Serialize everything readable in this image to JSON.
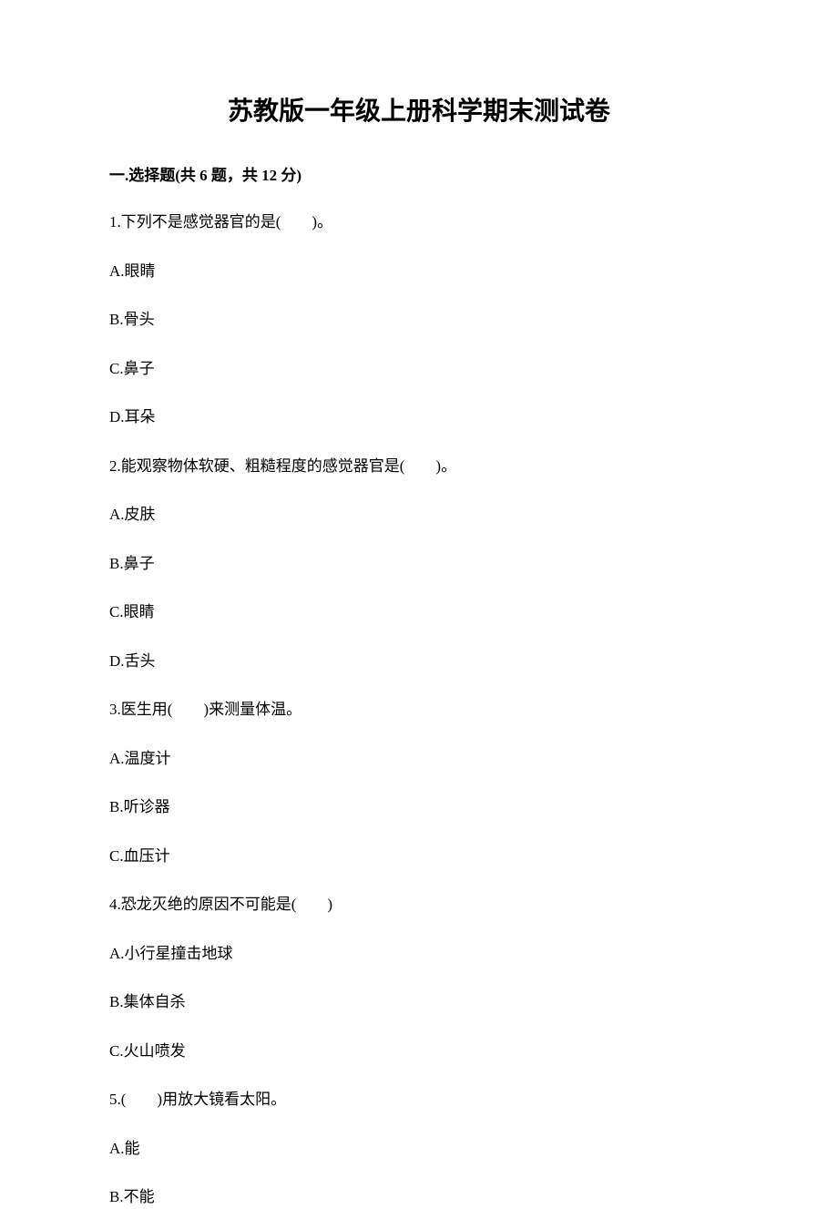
{
  "title": "苏教版一年级上册科学期末测试卷",
  "section": {
    "header": "一.选择题(共 6 题，共 12 分)"
  },
  "questions": [
    {
      "text": "1.下列不是感觉器官的是(　　)。",
      "options": [
        "A.眼睛",
        "B.骨头",
        "C.鼻子",
        "D.耳朵"
      ]
    },
    {
      "text": "2.能观察物体软硬、粗糙程度的感觉器官是(　　)。",
      "options": [
        "A.皮肤",
        "B.鼻子",
        "C.眼睛",
        "D.舌头"
      ]
    },
    {
      "text": "3.医生用(　　)来测量体温。",
      "options": [
        "A.温度计",
        "B.听诊器",
        "C.血压计"
      ]
    },
    {
      "text": "4.恐龙灭绝的原因不可能是(　　)",
      "options": [
        "A.小行星撞击地球",
        "B.集体自杀",
        "C.火山喷发"
      ]
    },
    {
      "text": "5.(　　)用放大镜看太阳。",
      "options": [
        "A.能",
        "B.不能"
      ]
    }
  ]
}
